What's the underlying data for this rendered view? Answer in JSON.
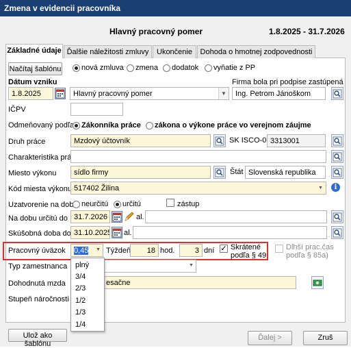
{
  "window": {
    "title": "Zmena v evidencii pracovníka"
  },
  "header": {
    "contract_type": "Hlavný pracovný pomer",
    "period": "1.8.2025 - 31.7.2026"
  },
  "tabs": [
    {
      "label": "Základné údaje",
      "active": true
    },
    {
      "label": "Ďalšie náležitosti zmluvy",
      "active": false
    },
    {
      "label": "Ukončenie",
      "active": false
    },
    {
      "label": "Dohoda o hmotnej zodpovednosti",
      "active": false
    }
  ],
  "template": {
    "load_label": "Načítaj šablónu",
    "save_label": "Ulož ako šablónu"
  },
  "contract_kind": {
    "options": [
      "nová zmluva",
      "zmena",
      "dodatok",
      "vyňatie z PP"
    ],
    "selected": "nová zmluva"
  },
  "origin": {
    "label": "Dátum vzniku",
    "date": "1.8.2025",
    "type_value": "Hlavný pracovný pomer",
    "signer_label": "Firma bola pri podpise zastúpená",
    "signer_value": "Ing. Petrom Jánoškom"
  },
  "icpv": {
    "label": "IČPV",
    "value": ""
  },
  "remuneration": {
    "label": "Odmeňovaný podľa",
    "options": [
      "Zákonníka práce",
      "zákona o výkone práce vo verejnom záujme"
    ],
    "selected": "Zákonníka práce"
  },
  "job": {
    "type_label": "Druh práce",
    "type_value": "Mzdový účtovník",
    "isco_label": "SK ISCO-08",
    "isco_value": "3313001",
    "char_label": "Charakteristika práce",
    "char_value": ""
  },
  "place": {
    "label": "Miesto výkonu",
    "value": "sídlo firmy",
    "state_label": "Štát",
    "state_value": "Slovenská republika",
    "code_label": "Kód miesta výkonu",
    "code_value": "517402 Žilina"
  },
  "duration": {
    "label": "Uzatvorenie na dobu",
    "options": [
      "neurčitú",
      "určitú"
    ],
    "selected": "určitú",
    "temp_label": "zástup",
    "fixed_label": "Na dobu určitú do",
    "fixed_date": "31.7.2026",
    "fixed_al": "al.",
    "trial_label": "Skúšobná doba do",
    "trial_date": "31.10.2025",
    "trial_al": "al."
  },
  "workload": {
    "label": "Pracovný úväzok",
    "value": "0,45",
    "week_label": "Týždeň",
    "hours": "18",
    "hours_unit": "hod.",
    "days": "3",
    "days_unit": "dní",
    "shortened_label": "Skrátené podľa § 49",
    "shortened_checked": true,
    "longer_label": "Dlhší prac.čas podľa § 85a)"
  },
  "workload_options": [
    "plný",
    "3/4",
    "2/3",
    "1/2",
    "1/3",
    "1/4"
  ],
  "employee_type": {
    "label": "Typ zamestnanca",
    "value": ""
  },
  "wage": {
    "label": "Dohodnutá mzda",
    "value_visible": "esačne"
  },
  "difficulty": {
    "label": "Stupeň náročnosti"
  },
  "footer": {
    "next_label": "Ďalej >",
    "cancel_label": "Zruš"
  },
  "colors": {
    "titlebar": "#1b3f73",
    "highlight_box": "#e0302a",
    "required_field": "#fcf7d8"
  }
}
